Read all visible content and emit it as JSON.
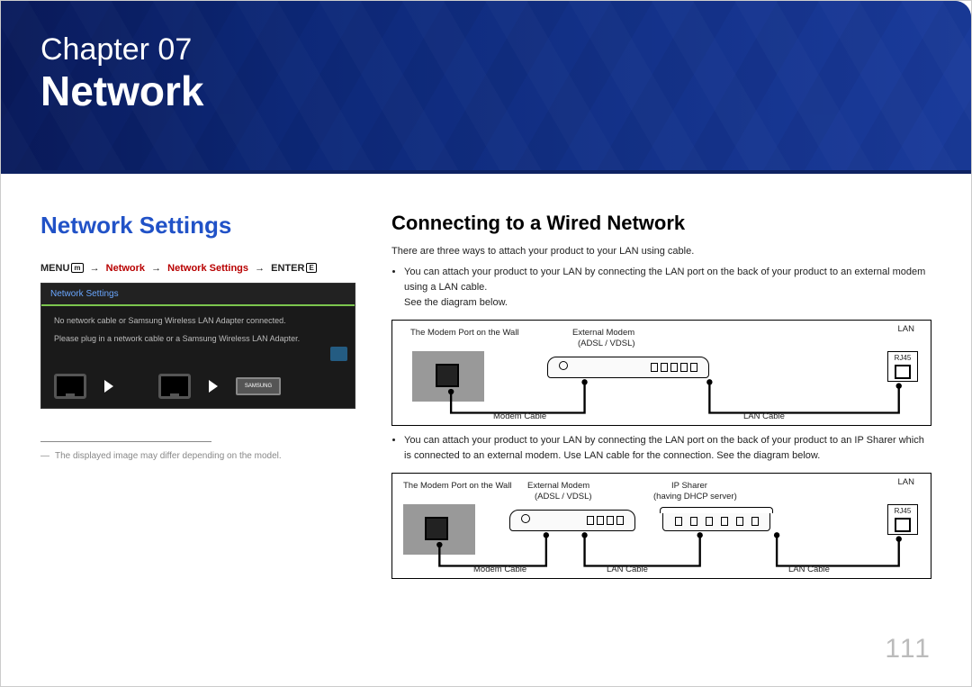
{
  "hero": {
    "chapter_label": "Chapter  07",
    "chapter_title": "Network"
  },
  "left": {
    "section_title": "Network Settings",
    "menu_path": {
      "menu": "MENU",
      "menu_icon": "m",
      "p1": "Network",
      "p2": "Network Settings",
      "enter": "ENTER",
      "enter_icon": "E"
    },
    "osd": {
      "tab": "Network Settings",
      "line1": "No network cable or Samsung Wireless LAN Adapter connected.",
      "line2": "Please plug in a network cable or a Samsung Wireless LAN Adapter.",
      "dongle": "SAMSUNG"
    },
    "footnote": "The displayed image may differ depending on the model."
  },
  "right": {
    "heading": "Connecting to a Wired Network",
    "intro": "There are three ways to attach your product to your LAN using cable.",
    "bullets": {
      "b1": "You can attach your product to your LAN by connecting the LAN port on the back of your product to an external modem using a LAN cable.",
      "b1_sub": "See the diagram below.",
      "b2": "You can attach your product to your LAN by connecting the LAN port on the back of your product to an IP Sharer which is connected to an external modem. Use LAN cable for the connection. See the diagram below."
    },
    "diag1": {
      "wall": "The Modem Port on the Wall",
      "modem1": "External Modem",
      "modem2": "(ADSL / VDSL)",
      "lan": "LAN",
      "rj": "RJ45",
      "c1": "Modem Cable",
      "c2": "LAN Cable"
    },
    "diag2": {
      "wall": "The Modem Port on the Wall",
      "modem1": "External Modem",
      "modem2": "(ADSL / VDSL)",
      "sharer1": "IP Sharer",
      "sharer2": "(having DHCP server)",
      "lan": "LAN",
      "rj": "RJ45",
      "c1": "Modem Cable",
      "c2": "LAN Cable",
      "c3": "LAN Cable"
    }
  },
  "page_number": "111"
}
